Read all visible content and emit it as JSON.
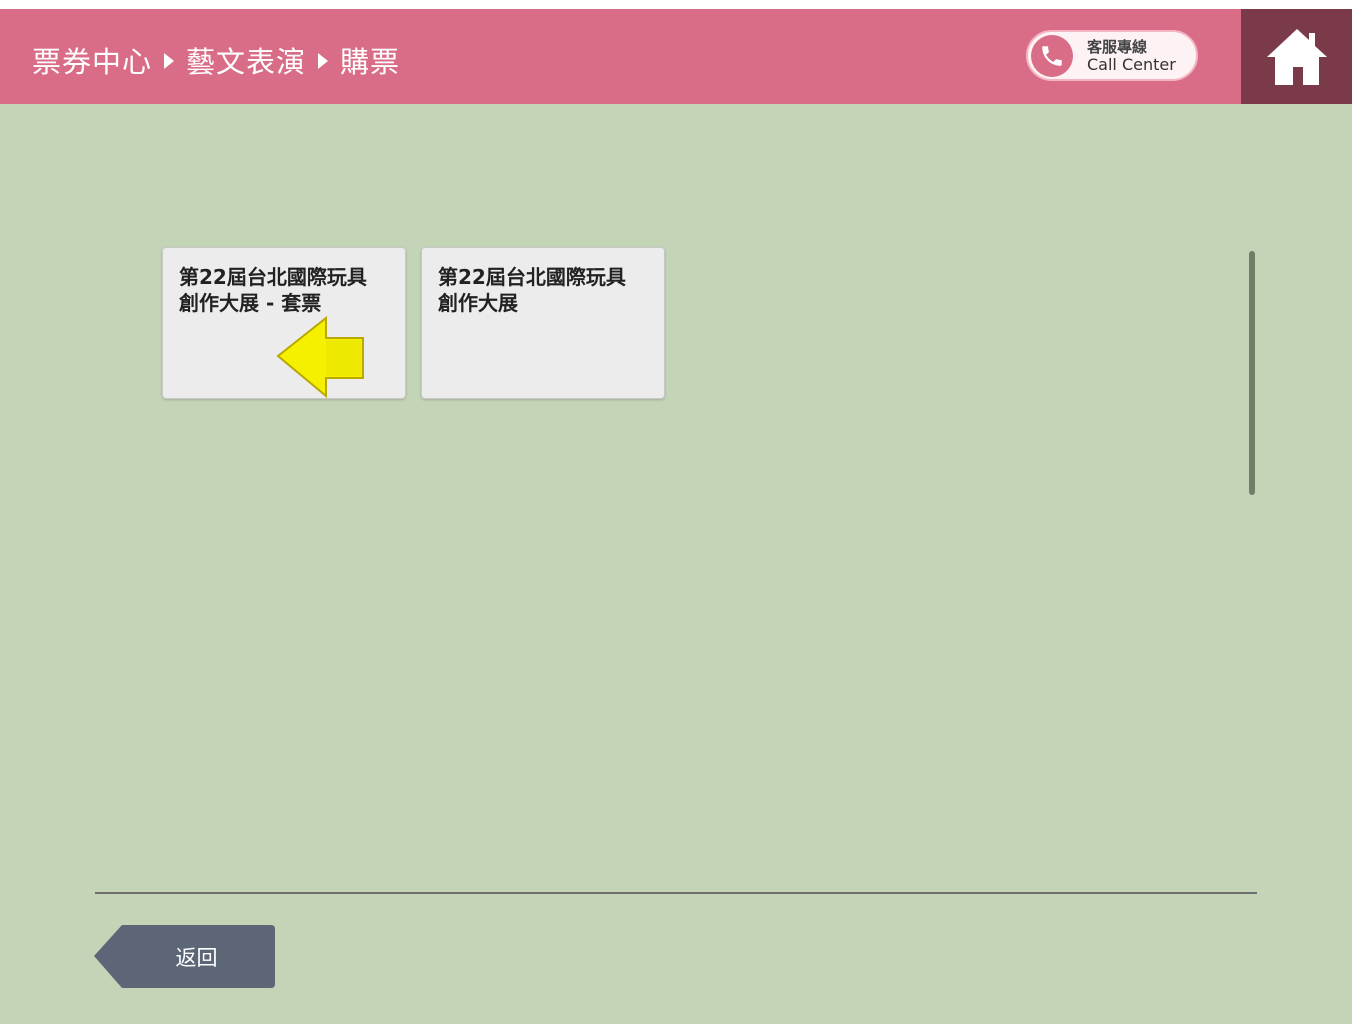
{
  "header": {
    "breadcrumb": [
      "票券中心",
      "藝文表演",
      "購票"
    ],
    "call_center": {
      "label_zh": "客服專線",
      "label_en": "Call Center",
      "icon": "phone-icon"
    },
    "home_icon": "home-icon"
  },
  "events": [
    {
      "line1": "第22屆台北國際玩具",
      "line2": "創作大展 - 套票"
    },
    {
      "line1": "第22屆台北國際玩具",
      "line2": "創作大展"
    }
  ],
  "footer": {
    "back_label": "返回"
  },
  "colors": {
    "header_bg": "#d96d87",
    "home_bg": "#7a3a4a",
    "body_bg": "#c4d4b6",
    "card_bg": "#ececec",
    "back_button_bg": "#5d6677",
    "pointer_fill": "#f5f000"
  }
}
